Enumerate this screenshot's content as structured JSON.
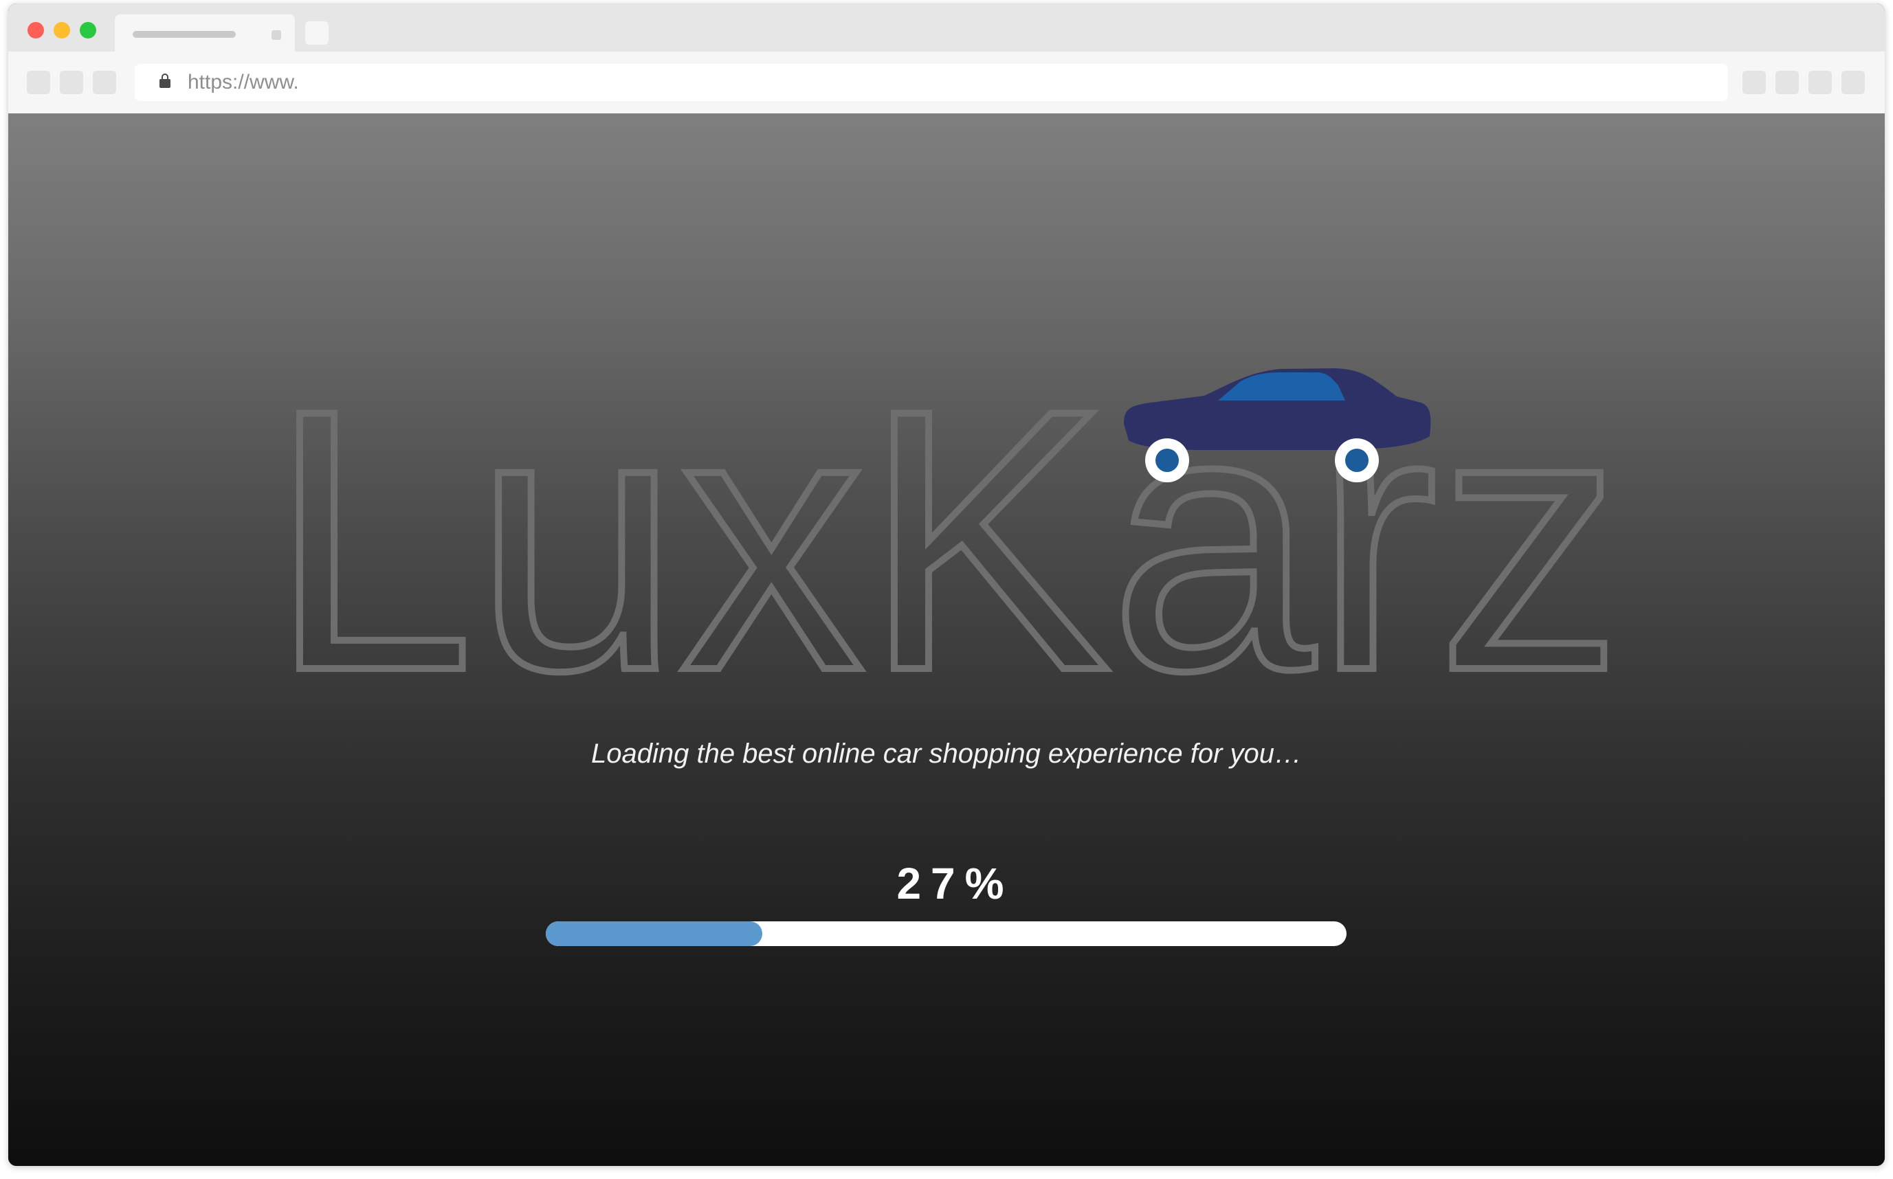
{
  "browser": {
    "url": "https://www.",
    "traffic_lights": [
      "close",
      "minimize",
      "zoom"
    ],
    "icons": {
      "lock": "lock-icon"
    }
  },
  "page": {
    "logo_text": "LuxKarz",
    "logo_icon": "car-icon",
    "tagline": "Loading the best online car shopping experience for you…",
    "progress_label": "27%",
    "progress_value": 0.27,
    "colors": {
      "progress_fill": "#5b99cf",
      "progress_track": "#ffffff",
      "car_body": "#2e3166",
      "car_window": "#1c62aa",
      "wheel_hub": "#1c5c9a",
      "logo_outline": "#6e6e6e"
    }
  }
}
